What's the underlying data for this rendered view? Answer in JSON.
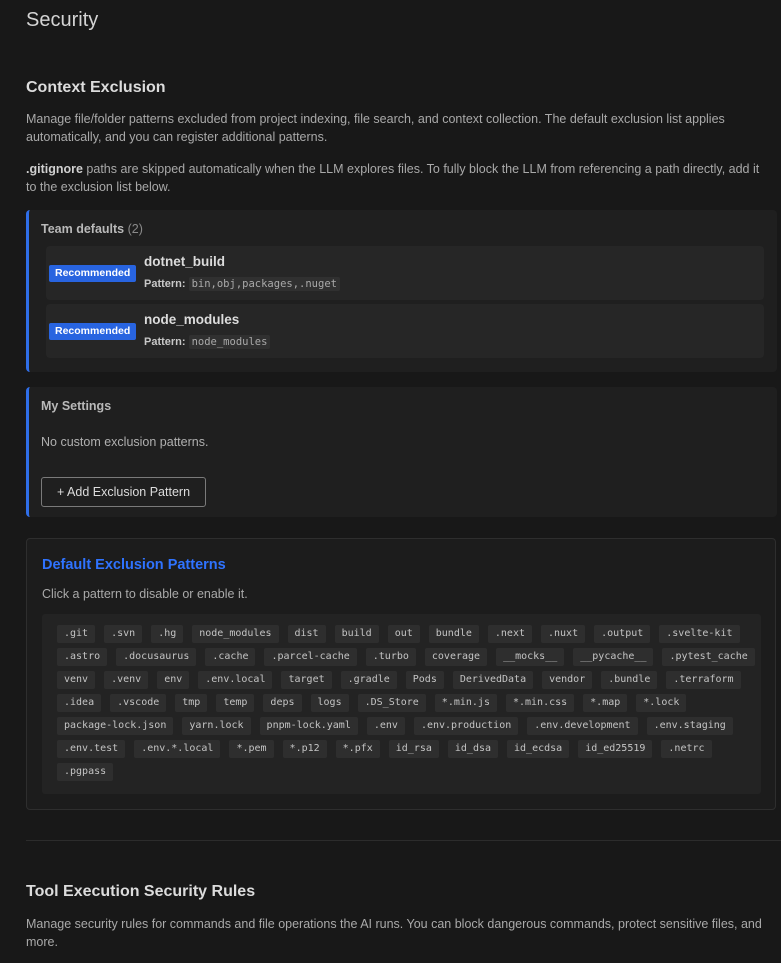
{
  "page": {
    "title": "Security"
  },
  "context_exclusion": {
    "title": "Context Exclusion",
    "desc1": "Manage file/folder patterns excluded from project indexing, file search, and context collection. The default exclusion list applies automatically, and you can register additional patterns.",
    "desc2_bold": ".gitignore",
    "desc2_rest": " paths are skipped automatically when the LLM explores files. To fully block the LLM from referencing a path directly, add it to the exclusion list below."
  },
  "team_defaults": {
    "label": "Team defaults",
    "count": "(2)",
    "items": [
      {
        "badge": "Recommended",
        "name": "dotnet_build",
        "pattern_label": "Pattern:",
        "pattern": "bin,obj,packages,.nuget"
      },
      {
        "badge": "Recommended",
        "name": "node_modules",
        "pattern_label": "Pattern:",
        "pattern": "node_modules"
      }
    ]
  },
  "my_settings": {
    "label": "My Settings",
    "empty_text": "No custom exclusion patterns.",
    "add_button": "+ Add Exclusion Pattern"
  },
  "default_patterns": {
    "title": "Default Exclusion Patterns",
    "desc": "Click a pattern to disable or enable it.",
    "rows": [
      [
        ".git",
        ".svn",
        ".hg",
        "node_modules",
        "dist",
        "build",
        "out",
        "bundle",
        ".next",
        ".nuxt",
        ".output",
        ".svelte-kit"
      ],
      [
        ".astro",
        ".docusaurus",
        ".cache",
        ".parcel-cache",
        ".turbo",
        "coverage",
        "__mocks__",
        "__pycache__",
        ".pytest_cache"
      ],
      [
        "venv",
        ".venv",
        "env",
        ".env.local",
        "target",
        ".gradle",
        "Pods",
        "DerivedData",
        "vendor",
        ".bundle",
        ".terraform"
      ],
      [
        ".idea",
        ".vscode",
        "tmp",
        "temp",
        "deps",
        "logs",
        ".DS_Store",
        "*.min.js",
        "*.min.css",
        "*.map",
        "*.lock"
      ],
      [
        "package-lock.json",
        "yarn.lock",
        "pnpm-lock.yaml",
        ".env",
        ".env.production",
        ".env.development",
        ".env.staging"
      ],
      [
        ".env.test",
        ".env.*.local",
        "*.pem",
        "*.p12",
        "*.pfx",
        "id_rsa",
        "id_dsa",
        "id_ecdsa",
        "id_ed25519",
        ".netrc"
      ],
      [
        ".pgpass"
      ]
    ]
  },
  "tool_rules": {
    "title": "Tool Execution Security Rules",
    "desc": "Manage security rules for commands and file operations the AI runs. You can block dangerous commands, protect sensitive files, and more."
  },
  "colors": {
    "accent": "#2f6ee8",
    "badge": "#2864e0",
    "link_title": "#2f73ff",
    "background": "#181818"
  }
}
